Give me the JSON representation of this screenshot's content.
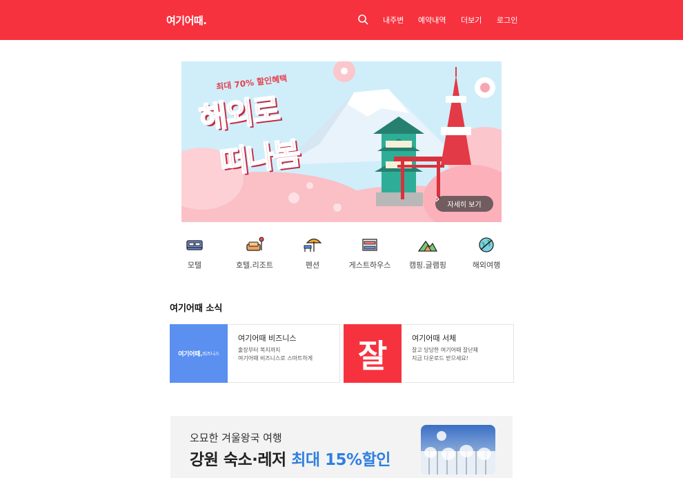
{
  "header": {
    "logo": "여기어때.",
    "nav": [
      "내주변",
      "예약내역",
      "더보기",
      "로그인"
    ],
    "search_icon": "search-icon",
    "bg_color": "#f7323f"
  },
  "hero": {
    "promo": "최대 70% 할인혜택",
    "title_line1": "해외로",
    "title_line2": "떠나봄",
    "button_label": "자세히 보기",
    "button_icon": "chevron-right-icon"
  },
  "categories": [
    {
      "label": "모텔",
      "icon": "motel-bed-icon"
    },
    {
      "label": "호텔.리조트",
      "icon": "hotel-sofa-icon"
    },
    {
      "label": "펜션",
      "icon": "pension-parasol-icon"
    },
    {
      "label": "게스트하우스",
      "icon": "guesthouse-bunk-icon"
    },
    {
      "label": "캠핑.글램핑",
      "icon": "camping-mountain-icon"
    },
    {
      "label": "해외여행",
      "icon": "globe-plane-icon"
    }
  ],
  "news": {
    "title": "여기어때 소식",
    "cards": [
      {
        "title": "여기어때 비즈니스",
        "desc_line1": "출장부터 복지까지",
        "desc_line2": "여기어때 비즈니스로 스마트하게",
        "thumb_text": "여기어때.",
        "thumb_sub": "비즈니스",
        "thumb_color": "#5b8ff0"
      },
      {
        "title": "여기어때 서체",
        "desc_line1": "잘고 당당한 여기어때 잘난체",
        "desc_line2": "지금 다운로드 받으세요!",
        "thumb_text": "잘",
        "thumb_color": "#f7323f"
      }
    ]
  },
  "banner": {
    "line1": "오묘한 겨울왕국 여행",
    "line2_prefix": "강원 숙소·레저 ",
    "line2_highlight": "최대 15%할인",
    "highlight_color": "#2f7fe0"
  }
}
